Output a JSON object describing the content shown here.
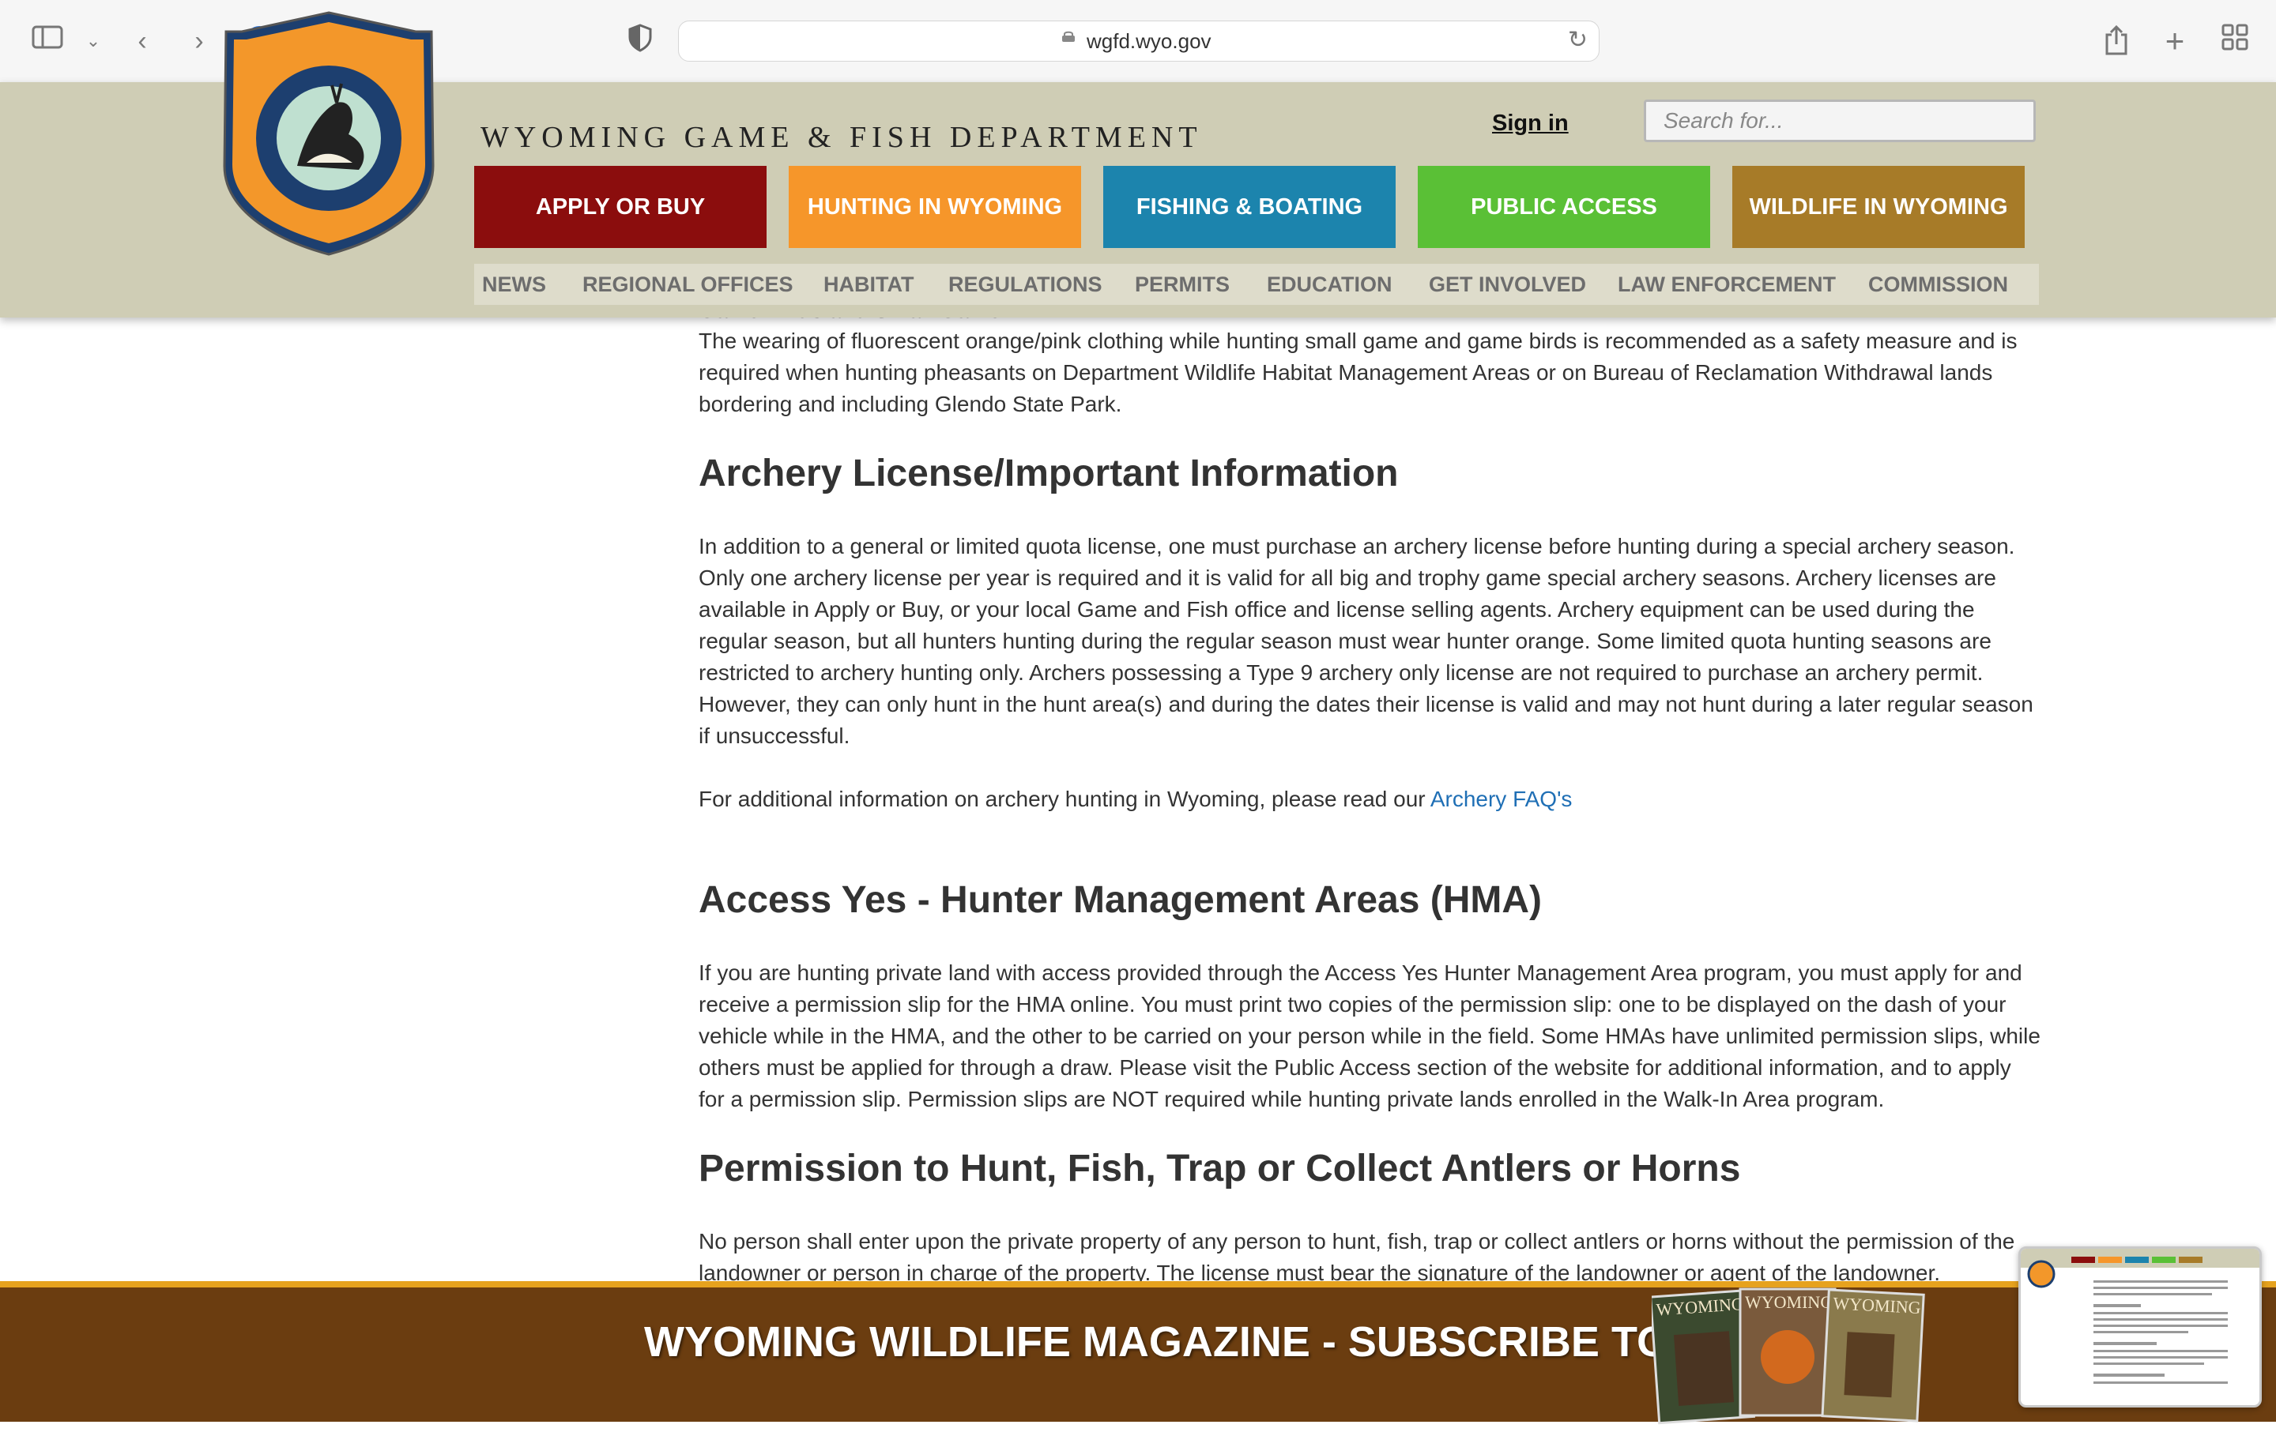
{
  "browser": {
    "url": "wgfd.wyo.gov"
  },
  "header": {
    "department_title": "WYOMING GAME & FISH DEPARTMENT",
    "signin_label": "Sign in",
    "search_placeholder": "Search for...",
    "logo_text": "WYOMING GAME & FISH DEPARTMENT",
    "main_nav": [
      {
        "label": "APPLY OR BUY",
        "color": "#8b0d0d"
      },
      {
        "label": "HUNTING IN WYOMING",
        "color": "#f6962a"
      },
      {
        "label": "FISHING & BOATING",
        "color": "#1c84ad"
      },
      {
        "label": "PUBLIC ACCESS",
        "color": "#5ac036"
      },
      {
        "label": "WILDLIFE IN WYOMING",
        "color": "#a77b28"
      }
    ],
    "sub_nav": [
      "NEWS",
      "REGIONAL OFFICES",
      "HABITAT",
      "REGULATIONS",
      "PERMITS",
      "EDUCATION",
      "GET INVOLVED",
      "LAW ENFORCEMENT",
      "COMMISSION"
    ]
  },
  "content": {
    "cut_heading": "Game Birds and Small Game",
    "game_birds_text": "The wearing of fluorescent orange/pink clothing while hunting small game and game birds is recommended as a safety measure and is required when hunting pheasants on Department Wildlife Habitat Management Areas or on Bureau of Reclamation Withdrawal lands bordering and including Glendo State Park.",
    "archery_heading": "Archery License/Important Information",
    "archery_text": "In addition to a general or limited quota license, one must purchase an archery license before hunting during a special archery season. Only one archery license per year is required and it is valid for all big and trophy game special archery seasons. Archery licenses are available in Apply or Buy, or your local Game and Fish office and license selling agents. Archery equipment can be used during the regular season, but all hunters hunting during the regular season must wear hunter orange.  Some limited quota hunting seasons are restricted to archery hunting only. Archers possessing a Type 9 archery only license are not required to purchase an archery permit.  However, they can only hunt in the hunt area(s) and during the dates their license is valid and may not hunt during a later regular season if unsuccessful.",
    "archery_more_prefix": "For additional information on archery hunting in Wyoming, please read our ",
    "archery_faq_link": "Archery FAQ's",
    "hma_heading": "Access Yes - Hunter Management Areas (HMA)",
    "hma_text": "If you are hunting private land with access provided through the Access Yes Hunter Management Area program, you must apply for and receive a permission slip for the HMA online. You must print two copies of the permission slip: one to be displayed on the dash of your vehicle while in the HMA, and the other to be carried on your person while in the field. Some HMAs have unlimited permission slips, while others must be applied for through a draw. Please visit the Public Access section of the website for additional information, and to apply for a permission slip. Permission slips are NOT required while hunting private lands enrolled in the Walk-In Area program.",
    "permission_heading": "Permission to Hunt, Fish, Trap or Collect Antlers or Horns",
    "permission_text": "No person shall enter upon the private property of any person to hunt, fish, trap or collect antlers or horns without the permission of the landowner or person in charge of the property. The license must bear the signature of the landowner or agent of the landowner."
  },
  "banner": {
    "text": "WYOMING WILDLIFE MAGAZINE - SUBSCRIBE TODAY!",
    "magazine_title": "WYOMING"
  }
}
